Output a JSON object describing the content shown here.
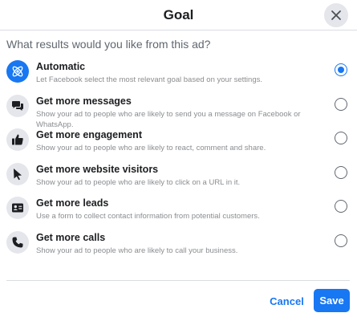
{
  "dialog": {
    "title": "Goal",
    "question": "What results would you like from this ad?"
  },
  "options": [
    {
      "title": "Automatic",
      "description": "Let Facebook select the most relevant goal based on your settings.",
      "icon": "atom-icon",
      "selected": true
    },
    {
      "title": "Get more messages",
      "description": "Show your ad to people who are likely to send you a message on Facebook or WhatsApp.",
      "icon": "chat-bubbles-icon",
      "selected": false
    },
    {
      "title": "Get more engagement",
      "description": "Show your ad to people who are likely to react, comment and share.",
      "icon": "thumbs-up-icon",
      "selected": false
    },
    {
      "title": "Get more website visitors",
      "description": "Show your ad to people who are likely to click on a URL in it.",
      "icon": "cursor-icon",
      "selected": false
    },
    {
      "title": "Get more leads",
      "description": "Use a form to collect contact information from potential customers.",
      "icon": "contact-card-icon",
      "selected": false
    },
    {
      "title": "Get more calls",
      "description": "Show your ad to people who are likely to call your business.",
      "icon": "phone-icon",
      "selected": false
    }
  ],
  "footer": {
    "cancel_label": "Cancel",
    "save_label": "Save"
  },
  "colors": {
    "accent": "#1877f2",
    "icon_bg": "#e4e6eb",
    "text": "#1c1e21",
    "muted": "#8a8d91"
  }
}
